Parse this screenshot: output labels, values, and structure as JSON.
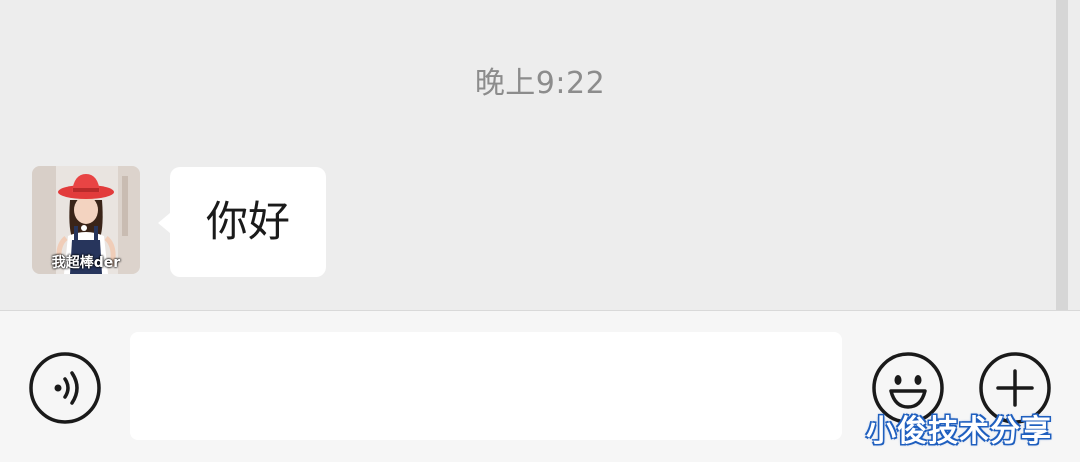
{
  "chat": {
    "timestamp": "晚上9:22",
    "messages": [
      {
        "sender": "other",
        "text": "你好",
        "avatar_caption": "我超棒der"
      }
    ]
  },
  "input_bar": {
    "text_value": "",
    "voice_icon": "voice-icon",
    "emoji_icon": "emoji-icon",
    "plus_icon": "plus-icon"
  },
  "watermark": "小俊技术分享",
  "colors": {
    "chat_background": "#ededed",
    "bubble_background": "#ffffff",
    "input_bar_background": "#f6f6f6",
    "timestamp_text": "#8c8c8c"
  }
}
